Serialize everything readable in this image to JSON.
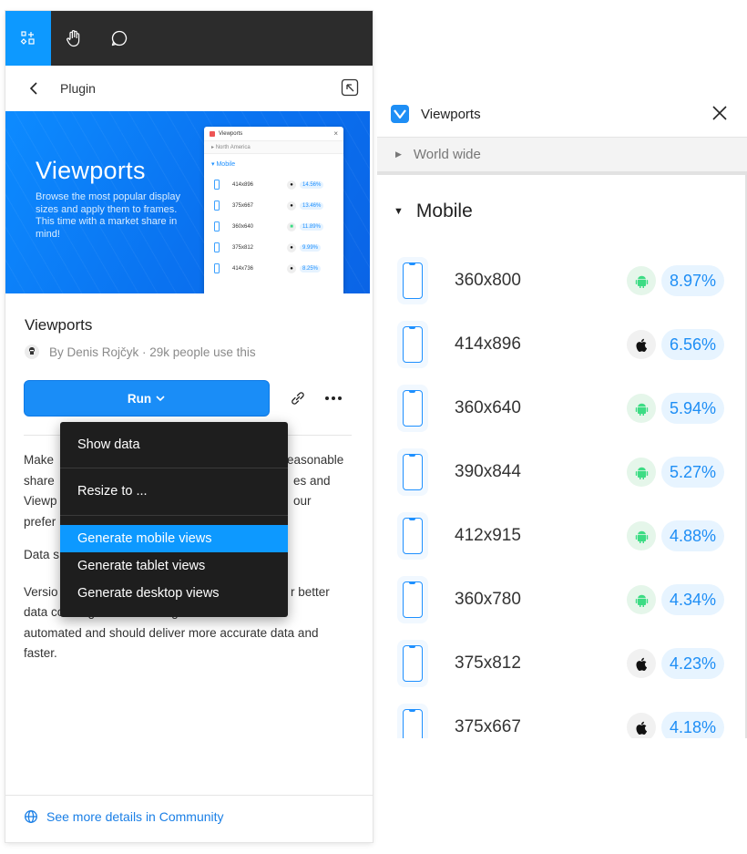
{
  "toolbar": {
    "tools": [
      "components-icon",
      "hand-icon",
      "comment-icon"
    ]
  },
  "plugin_header": {
    "title": "Plugin"
  },
  "banner": {
    "title": "Viewports",
    "description": "Browse the most popular display sizes and apply them to frames. This time with a market share in mind!",
    "mini_card": {
      "title": "Viewports",
      "region": "North America",
      "section": "Mobile",
      "rows": [
        {
          "res": "414x896",
          "os": "apple",
          "pct": "14.56%"
        },
        {
          "res": "375x667",
          "os": "apple",
          "pct": "13.46%"
        },
        {
          "res": "360x640",
          "os": "android",
          "pct": "11.89%"
        },
        {
          "res": "375x812",
          "os": "apple",
          "pct": "9.99%"
        },
        {
          "res": "414x736",
          "os": "apple",
          "pct": "8.25%"
        }
      ]
    }
  },
  "plugin": {
    "name": "Viewports",
    "author_line": "By Denis Rojčyk · 29k people use this",
    "run_label": "Run",
    "run_chevron": "⌄"
  },
  "description": {
    "p1_a": "Make",
    "p1_b": "easonable",
    "p1_c": "share",
    "p1_d": "es and",
    "p1_e": "Viewp",
    "p1_f": "our",
    "p1_g": "prefer",
    "p2": "Data s",
    "p3_a": "Versio",
    "p3_b": "r better",
    "p3_c": "data coverage. All the background work is now",
    "p3_d": "automated and should deliver more accurate data and",
    "p3_e": "faster."
  },
  "context_menu": {
    "items": [
      "Show data",
      "Resize to ...",
      "Generate mobile views",
      "Generate tablet views",
      "Generate desktop views"
    ],
    "highlighted": "Generate mobile views"
  },
  "footer": {
    "link": "See more details in Community"
  },
  "viewports_panel": {
    "title": "Viewports",
    "world_wide": "World wide",
    "section": "Mobile",
    "devices": [
      {
        "res": "360x800",
        "os": "android",
        "pct": "8.97%"
      },
      {
        "res": "414x896",
        "os": "apple",
        "pct": "6.56%"
      },
      {
        "res": "360x640",
        "os": "android",
        "pct": "5.94%"
      },
      {
        "res": "390x844",
        "os": "android",
        "pct": "5.27%"
      },
      {
        "res": "412x915",
        "os": "android",
        "pct": "4.88%"
      },
      {
        "res": "360x780",
        "os": "android",
        "pct": "4.34%"
      },
      {
        "res": "375x812",
        "os": "apple",
        "pct": "4.23%"
      },
      {
        "res": "375x667",
        "os": "apple",
        "pct": "4.18%"
      }
    ]
  },
  "colors": {
    "accent": "#0d99ff",
    "toolbar": "#2c2c2c",
    "menu_bg": "#1e1e1e",
    "android": "#3ddc84",
    "pct_text": "#1e8ef5"
  }
}
